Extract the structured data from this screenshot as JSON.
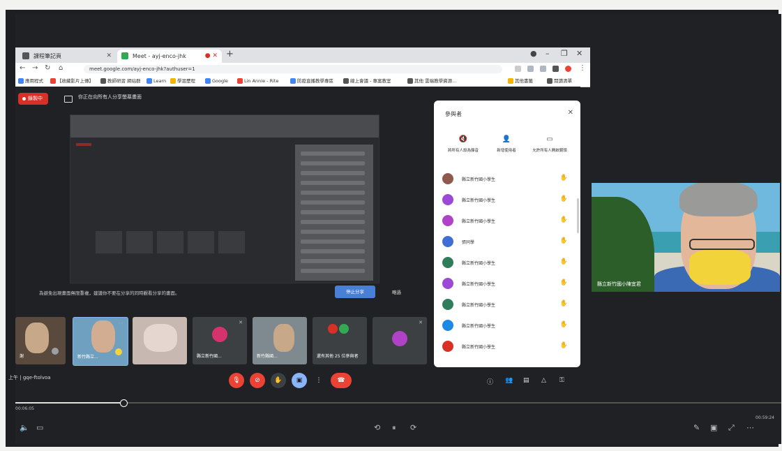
{
  "browser": {
    "tabs": [
      {
        "label": "課程筆記頁",
        "favicon_color": "#555555"
      },
      {
        "label": "Meet - ayj-enco-jhk",
        "favicon_color": "#34a853"
      }
    ],
    "url": "meet.google.com/ayj-enco-jhk?authuser=1",
    "bookmarks": [
      {
        "label": "應用程式",
        "color": "#4285f4"
      },
      {
        "label": "【收藏影片上傳】",
        "color": "#ea4335"
      },
      {
        "label": "教師研習 網站群",
        "color": "#555555"
      },
      {
        "label": "Learn",
        "color": "#4285f4"
      },
      {
        "label": "學習歷程",
        "color": "#f4b400"
      },
      {
        "label": "Google",
        "color": "#4285f4"
      },
      {
        "label": "Lin Annie - Rite",
        "color": "#ea4335"
      },
      {
        "label": "防疫直播教學專區",
        "color": "#4285f4"
      },
      {
        "label": "線上會議 - 專案教室",
        "color": "#555555"
      },
      {
        "label": "其他 雲端教學資源...",
        "color": "#555555"
      },
      {
        "label": "其他書籤",
        "color": "#f4b400"
      },
      {
        "label": "閱讀清單",
        "color": "#555555"
      }
    ]
  },
  "meet": {
    "recording_label": "錄製中",
    "presenting_text": "你正在向所有人分享螢幕畫面",
    "notice_text": "為避免出現畫面無限重複，建議你不要在分享的同時觀看分享的畫面。",
    "stop_button": "停止分享",
    "close_button": "略過",
    "tiles": [
      {
        "label": "謝",
        "type": "video"
      },
      {
        "label": "新竹縣立...",
        "type": "video"
      },
      {
        "label": "",
        "type": "video"
      },
      {
        "label": "縣立新竹國...",
        "type": "avatar",
        "color": "#d6336c"
      },
      {
        "label": "新竹縣國...",
        "type": "video"
      },
      {
        "label": "還有其他 25 位參與者",
        "type": "group"
      },
      {
        "label": "",
        "type": "avatar",
        "color": "#b042c8"
      }
    ],
    "meeting_time": "上午",
    "meeting_id": "gqe-ftolvoa",
    "people_panel": {
      "title": "參與者",
      "actions": [
        {
          "icon": "mute-all-icon",
          "label": "將所有人設為靜音"
        },
        {
          "icon": "add-person-icon",
          "label": "新增使用者"
        },
        {
          "icon": "camera-icon",
          "label": "允許所有人開啟鏡頭"
        }
      ],
      "people": [
        {
          "name": "縣立新竹國小學生",
          "color": "#8e5a4e"
        },
        {
          "name": "縣立新竹國小學生",
          "color": "#9c4ad6"
        },
        {
          "name": "縣立新竹國小學生",
          "color": "#b042c8"
        },
        {
          "name": "張同學",
          "color": "#3f6fd6"
        },
        {
          "name": "縣立新竹國小學生",
          "color": "#2f7d5a"
        },
        {
          "name": "縣立新竹國小學生",
          "color": "#9c4ad6"
        },
        {
          "name": "縣立新竹國小學生",
          "color": "#2f7d5a"
        },
        {
          "name": "縣立新竹國小學生",
          "color": "#1e88e5"
        },
        {
          "name": "縣立新竹國小學生",
          "color": "#d93025"
        }
      ]
    }
  },
  "speaker": {
    "label": "縣立新竹國小陳宜君"
  },
  "player": {
    "current_time": "00:06:05",
    "end_time": "00:59:24",
    "progress": 0.14
  }
}
